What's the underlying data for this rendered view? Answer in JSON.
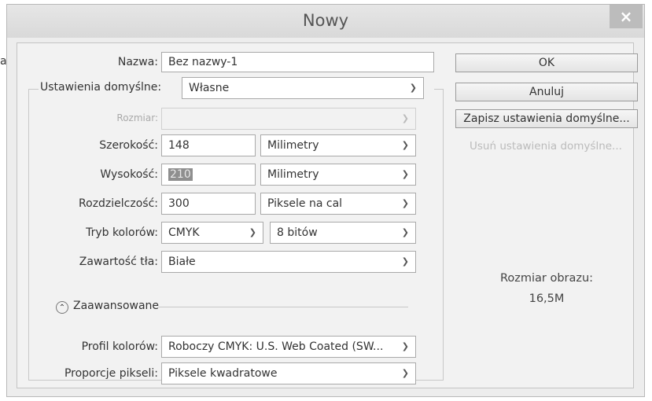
{
  "dialog": {
    "title": "Nowy",
    "close_symbol": "×"
  },
  "form": {
    "name_label": "Nazwa:",
    "name_value": "Bez nazwy-1",
    "preset_label": "Ustawienia domyślne:",
    "preset_value": "Własne",
    "size_label": "Rozmiar:",
    "width_label": "Szerokość:",
    "width_value": "148",
    "width_unit": "Milimetry",
    "height_label": "Wysokość:",
    "height_value": "210",
    "height_unit": "Milimetry",
    "resolution_label": "Rozdzielczość:",
    "resolution_value": "300",
    "resolution_unit": "Piksele na cal",
    "color_mode_label": "Tryb kolorów:",
    "color_mode_value": "CMYK",
    "bit_depth_value": "8 bitów",
    "background_label": "Zawartość tła:",
    "background_value": "Białe",
    "advanced_label": "Zaawansowane",
    "advanced_icon": "chevron-up",
    "color_profile_label": "Profil kolorów:",
    "color_profile_value": "Roboczy CMYK:  U.S. Web Coated (SW...",
    "pixel_aspect_label": "Proporcje pikseli:",
    "pixel_aspect_value": "Piksele kwadratowe"
  },
  "buttons": {
    "ok": "OK",
    "cancel": "Anuluj",
    "save_preset": "Zapisz ustawienia domyślne...",
    "delete_preset": "Usuń ustawienia domyślne..."
  },
  "info": {
    "image_size_label": "Rozmiar obrazu:",
    "image_size_value": "16,5M"
  },
  "sidebar_mark": "a"
}
